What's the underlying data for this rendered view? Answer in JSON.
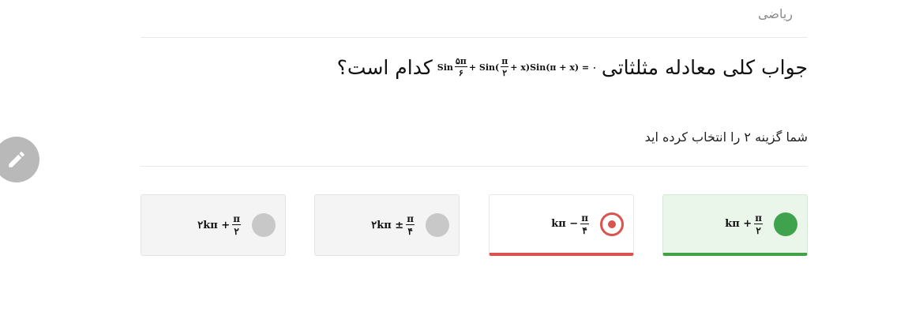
{
  "header": {
    "category": "ریاضی"
  },
  "question": {
    "text_before": "جواب کلی معادله مثلثاتی",
    "text_after": "کدام است؟",
    "formula": {
      "sin_label": "Sin",
      "frac1_num": "۵π",
      "frac1_den": "۶",
      "mid1": "+ Sin(",
      "frac2_num": "π",
      "frac2_den": "۲",
      "mid2": "+ x)Sin(π + x) = ۰"
    }
  },
  "selection_note": "شما گزینه ۲ را انتخاب کرده اید",
  "options": [
    {
      "lead": "kπ +",
      "num": "π",
      "den": "۲",
      "state": "correct"
    },
    {
      "lead": "kπ −",
      "num": "π",
      "den": "۴",
      "state": "selected-wrong"
    },
    {
      "lead": "۲kπ ±",
      "num": "π",
      "den": "۴",
      "state": "neutral"
    },
    {
      "lead": "۲kπ +",
      "num": "π",
      "den": "۲",
      "state": "neutral"
    }
  ],
  "icons": {
    "edit": "pencil-icon",
    "colors": {
      "correct": "#3fa34d",
      "wrong": "#d9534f",
      "neutral": "#c8c8c8",
      "fab": "#b9b9b9"
    }
  }
}
